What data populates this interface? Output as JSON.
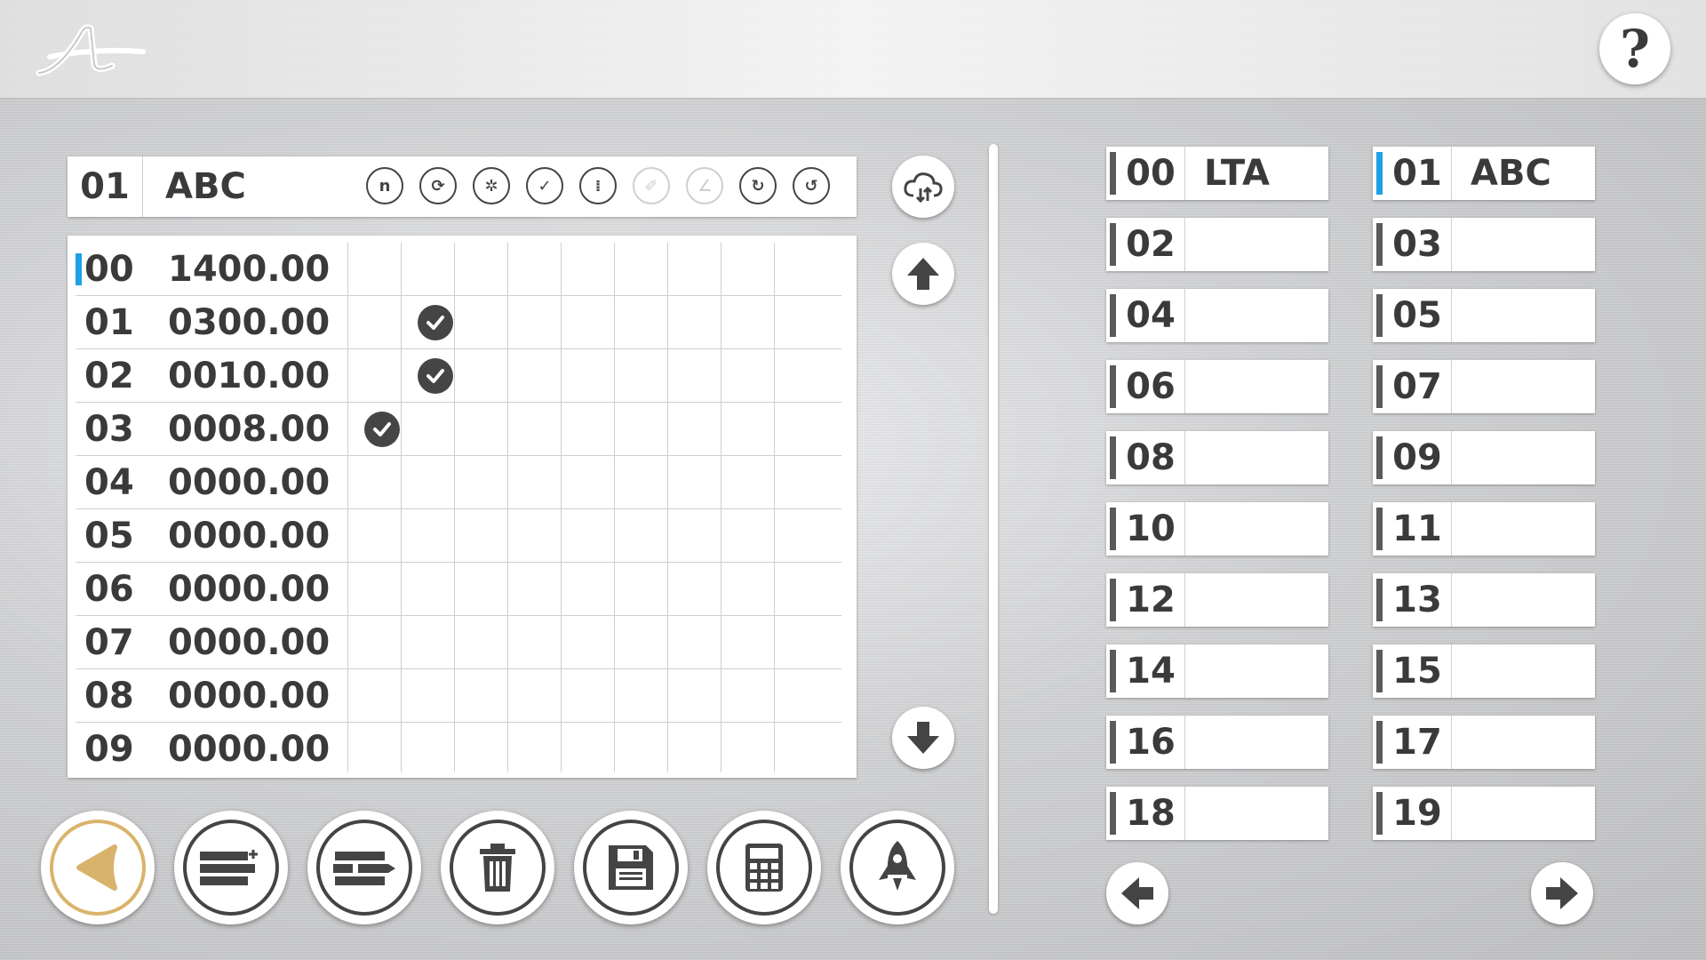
{
  "header": {
    "logo_text": "A",
    "help_label": "?"
  },
  "program": {
    "number": "01",
    "name": "ABC",
    "option_icons": [
      {
        "name": "n-icon",
        "glyph": "n",
        "enabled": true
      },
      {
        "name": "cycle-icon",
        "glyph": "⟳",
        "enabled": true
      },
      {
        "name": "squeeze-icon",
        "glyph": "✲",
        "enabled": true
      },
      {
        "name": "align-icon",
        "glyph": "✓",
        "enabled": true
      },
      {
        "name": "cut-icon",
        "glyph": "⁞",
        "enabled": true
      },
      {
        "name": "brush-icon",
        "glyph": "✐",
        "enabled": false
      },
      {
        "name": "angle-icon",
        "glyph": "∠",
        "enabled": false
      },
      {
        "name": "rotate-cw-icon",
        "glyph": "↻",
        "enabled": true
      },
      {
        "name": "rotate-ccw-icon",
        "glyph": "↺",
        "enabled": true
      }
    ]
  },
  "steps": [
    {
      "index": "00",
      "value": "1400.00",
      "selected": true,
      "checks": []
    },
    {
      "index": "01",
      "value": "0300.00",
      "selected": false,
      "checks": [
        1
      ]
    },
    {
      "index": "02",
      "value": "0010.00",
      "selected": false,
      "checks": [
        1
      ]
    },
    {
      "index": "03",
      "value": "0008.00",
      "selected": false,
      "checks": [
        0
      ]
    },
    {
      "index": "04",
      "value": "0000.00",
      "selected": false,
      "checks": []
    },
    {
      "index": "05",
      "value": "0000.00",
      "selected": false,
      "checks": []
    },
    {
      "index": "06",
      "value": "0000.00",
      "selected": false,
      "checks": []
    },
    {
      "index": "07",
      "value": "0000.00",
      "selected": false,
      "checks": []
    },
    {
      "index": "08",
      "value": "0000.00",
      "selected": false,
      "checks": []
    },
    {
      "index": "09",
      "value": "0000.00",
      "selected": false,
      "checks": []
    }
  ],
  "side_buttons": [
    "cloud-sync-icon",
    "arrow-up-icon",
    "arrow-down-icon"
  ],
  "actions": [
    {
      "name": "back-button",
      "icon": "back-triangle-icon",
      "highlight": true
    },
    {
      "name": "insert-step-button",
      "icon": "insert-step-icon",
      "highlight": false
    },
    {
      "name": "move-step-button",
      "icon": "move-step-icon",
      "highlight": false
    },
    {
      "name": "delete-button",
      "icon": "trash-icon",
      "highlight": false
    },
    {
      "name": "save-button",
      "icon": "floppy-disk-icon",
      "highlight": false
    },
    {
      "name": "calculator-button",
      "icon": "calculator-icon",
      "highlight": false
    },
    {
      "name": "launch-button",
      "icon": "rocket-icon",
      "highlight": false
    }
  ],
  "programs": [
    {
      "number": "00",
      "name": "LTA",
      "active": false
    },
    {
      "number": "01",
      "name": "ABC",
      "active": true
    },
    {
      "number": "02",
      "name": "",
      "active": false
    },
    {
      "number": "03",
      "name": "",
      "active": false
    },
    {
      "number": "04",
      "name": "",
      "active": false
    },
    {
      "number": "05",
      "name": "",
      "active": false
    },
    {
      "number": "06",
      "name": "",
      "active": false
    },
    {
      "number": "07",
      "name": "",
      "active": false
    },
    {
      "number": "08",
      "name": "",
      "active": false
    },
    {
      "number": "09",
      "name": "",
      "active": false
    },
    {
      "number": "10",
      "name": "",
      "active": false
    },
    {
      "number": "11",
      "name": "",
      "active": false
    },
    {
      "number": "12",
      "name": "",
      "active": false
    },
    {
      "number": "13",
      "name": "",
      "active": false
    },
    {
      "number": "14",
      "name": "",
      "active": false
    },
    {
      "number": "15",
      "name": "",
      "active": false
    },
    {
      "number": "16",
      "name": "",
      "active": false
    },
    {
      "number": "17",
      "name": "",
      "active": false
    },
    {
      "number": "18",
      "name": "",
      "active": false
    },
    {
      "number": "19",
      "name": "",
      "active": false
    }
  ],
  "pager": [
    "arrow-left-icon",
    "arrow-right-icon"
  ],
  "colors": {
    "selected_accent": "#1ea0e6",
    "back_ring": "#d9b36b",
    "icon_dark": "#444444"
  }
}
